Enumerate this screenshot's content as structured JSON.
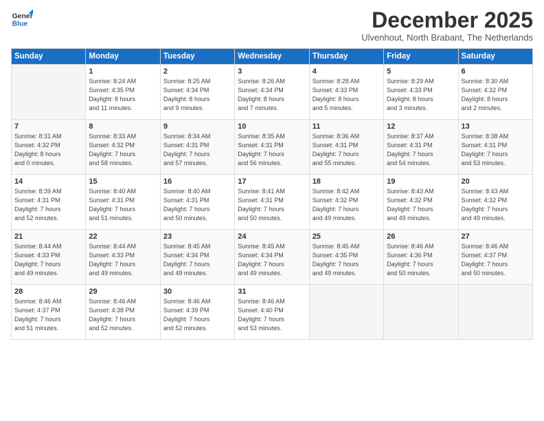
{
  "logo": {
    "general": "General",
    "blue": "Blue"
  },
  "title": "December 2025",
  "subtitle": "Ulvenhout, North Brabant, The Netherlands",
  "days_of_week": [
    "Sunday",
    "Monday",
    "Tuesday",
    "Wednesday",
    "Thursday",
    "Friday",
    "Saturday"
  ],
  "weeks": [
    [
      {
        "num": "",
        "info": ""
      },
      {
        "num": "1",
        "info": "Sunrise: 8:24 AM\nSunset: 4:35 PM\nDaylight: 8 hours\nand 11 minutes."
      },
      {
        "num": "2",
        "info": "Sunrise: 8:25 AM\nSunset: 4:34 PM\nDaylight: 8 hours\nand 9 minutes."
      },
      {
        "num": "3",
        "info": "Sunrise: 8:26 AM\nSunset: 4:34 PM\nDaylight: 8 hours\nand 7 minutes."
      },
      {
        "num": "4",
        "info": "Sunrise: 8:28 AM\nSunset: 4:33 PM\nDaylight: 8 hours\nand 5 minutes."
      },
      {
        "num": "5",
        "info": "Sunrise: 8:29 AM\nSunset: 4:33 PM\nDaylight: 8 hours\nand 3 minutes."
      },
      {
        "num": "6",
        "info": "Sunrise: 8:30 AM\nSunset: 4:32 PM\nDaylight: 8 hours\nand 2 minutes."
      }
    ],
    [
      {
        "num": "7",
        "info": "Sunrise: 8:31 AM\nSunset: 4:32 PM\nDaylight: 8 hours\nand 0 minutes."
      },
      {
        "num": "8",
        "info": "Sunrise: 8:33 AM\nSunset: 4:32 PM\nDaylight: 7 hours\nand 58 minutes."
      },
      {
        "num": "9",
        "info": "Sunrise: 8:34 AM\nSunset: 4:31 PM\nDaylight: 7 hours\nand 57 minutes."
      },
      {
        "num": "10",
        "info": "Sunrise: 8:35 AM\nSunset: 4:31 PM\nDaylight: 7 hours\nand 56 minutes."
      },
      {
        "num": "11",
        "info": "Sunrise: 8:36 AM\nSunset: 4:31 PM\nDaylight: 7 hours\nand 55 minutes."
      },
      {
        "num": "12",
        "info": "Sunrise: 8:37 AM\nSunset: 4:31 PM\nDaylight: 7 hours\nand 54 minutes."
      },
      {
        "num": "13",
        "info": "Sunrise: 8:38 AM\nSunset: 4:31 PM\nDaylight: 7 hours\nand 53 minutes."
      }
    ],
    [
      {
        "num": "14",
        "info": "Sunrise: 8:39 AM\nSunset: 4:31 PM\nDaylight: 7 hours\nand 52 minutes."
      },
      {
        "num": "15",
        "info": "Sunrise: 8:40 AM\nSunset: 4:31 PM\nDaylight: 7 hours\nand 51 minutes."
      },
      {
        "num": "16",
        "info": "Sunrise: 8:40 AM\nSunset: 4:31 PM\nDaylight: 7 hours\nand 50 minutes."
      },
      {
        "num": "17",
        "info": "Sunrise: 8:41 AM\nSunset: 4:31 PM\nDaylight: 7 hours\nand 50 minutes."
      },
      {
        "num": "18",
        "info": "Sunrise: 8:42 AM\nSunset: 4:32 PM\nDaylight: 7 hours\nand 49 minutes."
      },
      {
        "num": "19",
        "info": "Sunrise: 8:43 AM\nSunset: 4:32 PM\nDaylight: 7 hours\nand 49 minutes."
      },
      {
        "num": "20",
        "info": "Sunrise: 8:43 AM\nSunset: 4:32 PM\nDaylight: 7 hours\nand 49 minutes."
      }
    ],
    [
      {
        "num": "21",
        "info": "Sunrise: 8:44 AM\nSunset: 4:33 PM\nDaylight: 7 hours\nand 49 minutes."
      },
      {
        "num": "22",
        "info": "Sunrise: 8:44 AM\nSunset: 4:33 PM\nDaylight: 7 hours\nand 49 minutes."
      },
      {
        "num": "23",
        "info": "Sunrise: 8:45 AM\nSunset: 4:34 PM\nDaylight: 7 hours\nand 49 minutes."
      },
      {
        "num": "24",
        "info": "Sunrise: 8:45 AM\nSunset: 4:34 PM\nDaylight: 7 hours\nand 49 minutes."
      },
      {
        "num": "25",
        "info": "Sunrise: 8:45 AM\nSunset: 4:35 PM\nDaylight: 7 hours\nand 49 minutes."
      },
      {
        "num": "26",
        "info": "Sunrise: 8:46 AM\nSunset: 4:36 PM\nDaylight: 7 hours\nand 50 minutes."
      },
      {
        "num": "27",
        "info": "Sunrise: 8:46 AM\nSunset: 4:37 PM\nDaylight: 7 hours\nand 50 minutes."
      }
    ],
    [
      {
        "num": "28",
        "info": "Sunrise: 8:46 AM\nSunset: 4:37 PM\nDaylight: 7 hours\nand 51 minutes."
      },
      {
        "num": "29",
        "info": "Sunrise: 8:46 AM\nSunset: 4:38 PM\nDaylight: 7 hours\nand 52 minutes."
      },
      {
        "num": "30",
        "info": "Sunrise: 8:46 AM\nSunset: 4:39 PM\nDaylight: 7 hours\nand 52 minutes."
      },
      {
        "num": "31",
        "info": "Sunrise: 8:46 AM\nSunset: 4:40 PM\nDaylight: 7 hours\nand 53 minutes."
      },
      {
        "num": "",
        "info": ""
      },
      {
        "num": "",
        "info": ""
      },
      {
        "num": "",
        "info": ""
      }
    ]
  ]
}
